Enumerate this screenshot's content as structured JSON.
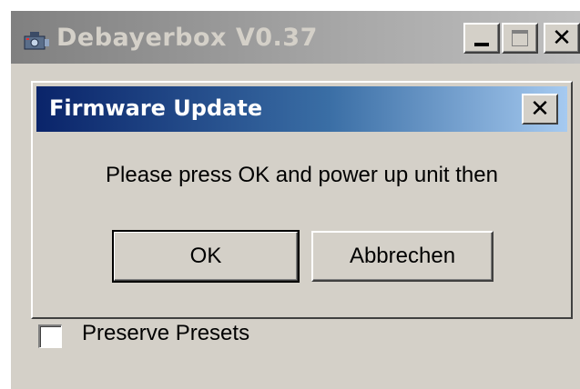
{
  "main_window": {
    "title": "Debayerbox V0.37",
    "icon": "app-camera-icon",
    "controls": [
      "minimize-icon",
      "maximize-icon",
      "close-icon"
    ]
  },
  "dialog": {
    "title": "Firmware Update",
    "message": "Please press OK and power up unit then",
    "ok_label": "OK",
    "cancel_label": "Abbrechen",
    "close_glyph": "✕"
  },
  "options": {
    "preserve_presets_label": "Preserve Presets",
    "preserve_presets_checked": false
  },
  "colors": {
    "dialog_title_start": "#0a246a",
    "dialog_title_end": "#a6caf0",
    "window_bg": "#d4d0c8"
  }
}
